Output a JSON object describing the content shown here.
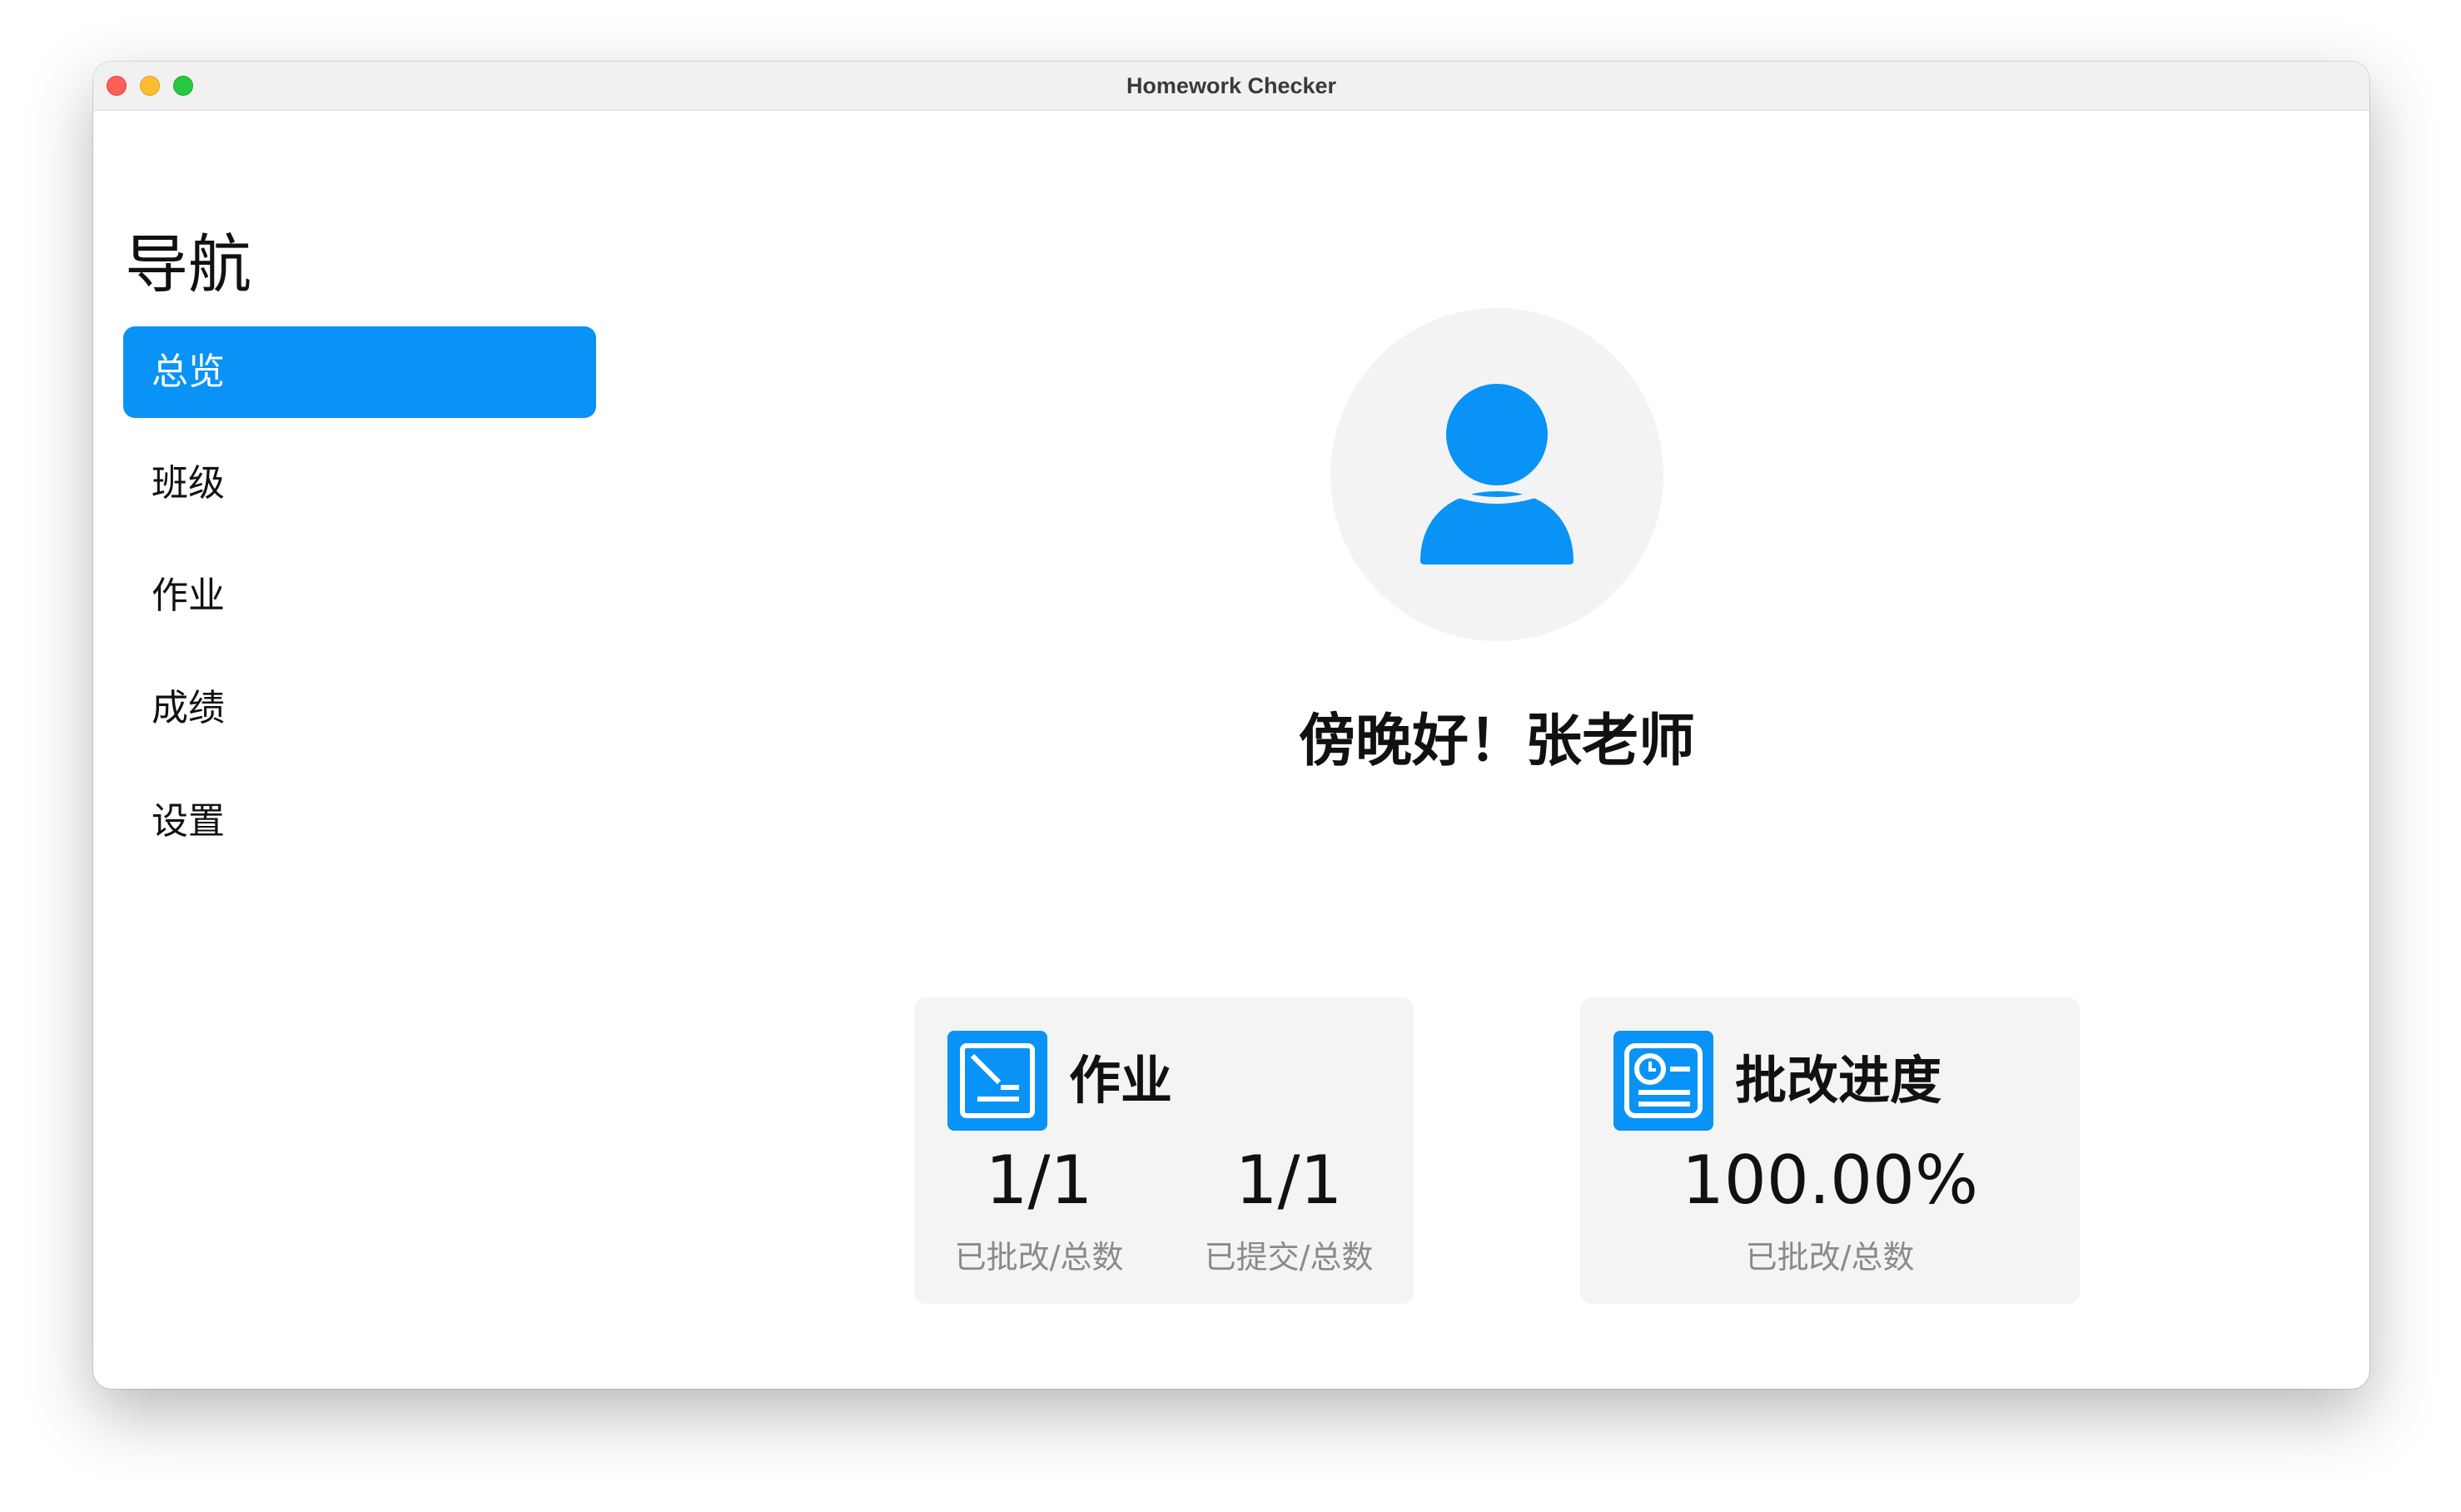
{
  "window": {
    "title": "Homework Checker"
  },
  "sidebar": {
    "heading": "导航",
    "items": [
      {
        "label": "总览",
        "active": true
      },
      {
        "label": "班级",
        "active": false
      },
      {
        "label": "作业",
        "active": false
      },
      {
        "label": "成绩",
        "active": false
      },
      {
        "label": "设置",
        "active": false
      }
    ]
  },
  "main": {
    "avatar_icon": "user-icon",
    "greeting": "傍晚好！张老师",
    "cards": [
      {
        "icon": "assignment-icon",
        "title": "作业",
        "stats": [
          {
            "value": "1/1",
            "label": "已批改/总数"
          },
          {
            "value": "1/1",
            "label": "已提交/总数"
          }
        ]
      },
      {
        "icon": "grading-progress-icon",
        "title": "批改进度",
        "stats": [
          {
            "value": "100.00%",
            "label": "已批改/总数"
          }
        ]
      }
    ]
  },
  "colors": {
    "accent": "#0a93f7",
    "card_bg": "#f4f4f4",
    "avatar_bg": "#f3f3f3",
    "label_gray": "#8a8a8a"
  }
}
